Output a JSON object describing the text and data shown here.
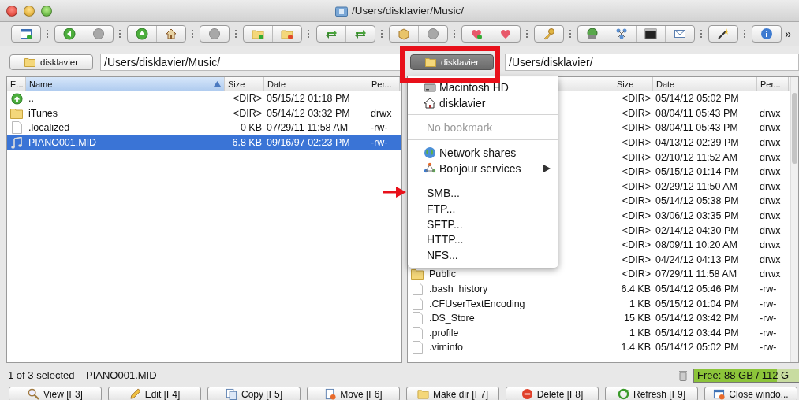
{
  "window": {
    "title": "/Users/disklavier/Music/"
  },
  "toolbar": {
    "overflow": "»"
  },
  "panes": [
    {
      "drive_button": {
        "label": "disklavier",
        "pressed": false
      },
      "path": "/Users/disklavier/Music/",
      "columns": [
        {
          "label": "E...",
          "sorted": false
        },
        {
          "label": "Name",
          "sorted": true
        },
        {
          "label": "Size",
          "sorted": false
        },
        {
          "label": "Date",
          "sorted": false
        },
        {
          "label": "Per...",
          "sorted": false
        }
      ],
      "rows": [
        {
          "kind": "up",
          "name": "..",
          "size": "<DIR>",
          "date": "05/15/12 01:18 PM",
          "selected": false
        },
        {
          "kind": "folder",
          "name": "iTunes",
          "size": "<DIR>",
          "date": "05/14/12 03:32 PM",
          "perm": "drwx",
          "selected": false
        },
        {
          "kind": "file",
          "name": ".localized",
          "size": "0 KB",
          "date": "07/29/11 11:58 AM",
          "perm": "-rw-",
          "selected": false
        },
        {
          "kind": "music",
          "name": "PIANO001.MID",
          "size": "6.8 KB",
          "date": "09/16/97 02:23 PM",
          "perm": "-rw-",
          "selected": true
        }
      ]
    },
    {
      "drive_button": {
        "label": "disklavier",
        "pressed": true
      },
      "path": "/Users/disklavier/",
      "columns": [
        {
          "label": "Size",
          "sorted": false
        },
        {
          "label": "Date",
          "sorted": false
        },
        {
          "label": "Per...",
          "sorted": false
        }
      ],
      "rows": [
        {
          "size": "<DIR>",
          "date": "05/14/12 05:02 PM",
          "selected": false
        },
        {
          "size": "<DIR>",
          "date": "08/04/11 05:43 PM",
          "perm": "drwx",
          "selected": false
        },
        {
          "size": "<DIR>",
          "date": "08/04/11 05:43 PM",
          "perm": "drwx",
          "selected": false
        },
        {
          "size": "<DIR>",
          "date": "04/13/12 02:39 PM",
          "perm": "drwx",
          "selected": false
        },
        {
          "size": "<DIR>",
          "date": "02/10/12 11:52 AM",
          "perm": "drwx",
          "selected": false
        },
        {
          "size": "<DIR>",
          "date": "05/15/12 01:14 PM",
          "perm": "drwx",
          "selected": false
        },
        {
          "size": "<DIR>",
          "date": "02/29/12 11:50 AM",
          "perm": "drwx",
          "selected": false
        },
        {
          "size": "<DIR>",
          "date": "05/14/12 05:38 PM",
          "perm": "drwx",
          "selected": false
        },
        {
          "size": "<DIR>",
          "date": "03/06/12 03:35 PM",
          "perm": "drwx",
          "selected": false
        },
        {
          "size": "<DIR>",
          "date": "02/14/12 04:30 PM",
          "perm": "drwx",
          "selected": false
        },
        {
          "size": "<DIR>",
          "date": "08/09/11 10:20 AM",
          "perm": "drwx",
          "selected": false
        },
        {
          "size": "<DIR>",
          "date": "04/24/12 04:13 PM",
          "perm": "drwx",
          "selected": false
        },
        {
          "kind": "folder",
          "name": "Public",
          "size": "<DIR>",
          "date": "07/29/11 11:58 AM",
          "perm": "drwx",
          "selected": false
        },
        {
          "kind": "file",
          "name": ".bash_history",
          "size": "6.4 KB",
          "date": "05/14/12 05:46 PM",
          "perm": "-rw-",
          "selected": false
        },
        {
          "kind": "file",
          "name": ".CFUserTextEncoding",
          "size": "1 KB",
          "date": "05/15/12 01:04 PM",
          "perm": "-rw-",
          "selected": false
        },
        {
          "kind": "file",
          "name": ".DS_Store",
          "size": "15 KB",
          "date": "05/14/12 03:42 PM",
          "perm": "-rw-",
          "selected": false
        },
        {
          "kind": "file",
          "name": ".profile",
          "size": "1 KB",
          "date": "05/14/12 03:44 PM",
          "perm": "-rw-",
          "selected": false
        },
        {
          "kind": "file",
          "name": ".viminfo",
          "size": "1.4 KB",
          "date": "05/14/12 05:02 PM",
          "perm": "-rw-",
          "selected": false
        }
      ]
    }
  ],
  "bookmark_menu": {
    "items": [
      {
        "kind": "disk",
        "label": "Macintosh HD",
        "disabled": false,
        "submenu": false
      },
      {
        "kind": "home",
        "label": "disklavier",
        "disabled": false,
        "submenu": false
      },
      {
        "kind": "separator"
      },
      {
        "kind": "plain",
        "label": "No bookmark",
        "disabled": true,
        "submenu": false
      },
      {
        "kind": "separator"
      },
      {
        "kind": "globe",
        "label": "Network shares",
        "disabled": false,
        "submenu": false
      },
      {
        "kind": "bonjour",
        "label": "Bonjour services",
        "disabled": false,
        "submenu": true
      },
      {
        "kind": "separator"
      },
      {
        "kind": "plain",
        "label": "SMB...",
        "disabled": false,
        "submenu": false
      },
      {
        "kind": "plain",
        "label": "FTP...",
        "disabled": false,
        "submenu": false
      },
      {
        "kind": "plain",
        "label": "SFTP...",
        "disabled": false,
        "submenu": false
      },
      {
        "kind": "plain",
        "label": "HTTP...",
        "disabled": false,
        "submenu": false
      },
      {
        "kind": "plain",
        "label": "NFS...",
        "disabled": false,
        "submenu": false
      }
    ]
  },
  "status": {
    "selection": "1 of 3 selected – PIANO001.MID",
    "free_space": "Free: 88 GB / 112 G",
    "level": 0.79
  },
  "function_buttons": [
    {
      "kind": "view",
      "label": "View [F3]"
    },
    {
      "kind": "edit",
      "label": "Edit [F4]"
    },
    {
      "kind": "copy",
      "label": "Copy [F5]"
    },
    {
      "kind": "move",
      "label": "Move [F6]"
    },
    {
      "kind": "mkdir",
      "label": "Make dir [F7]"
    },
    {
      "kind": "delete",
      "label": "Delete [F8]"
    },
    {
      "kind": "refresh",
      "label": "Refresh [F9]"
    },
    {
      "kind": "close",
      "label": "Close windo..."
    }
  ]
}
